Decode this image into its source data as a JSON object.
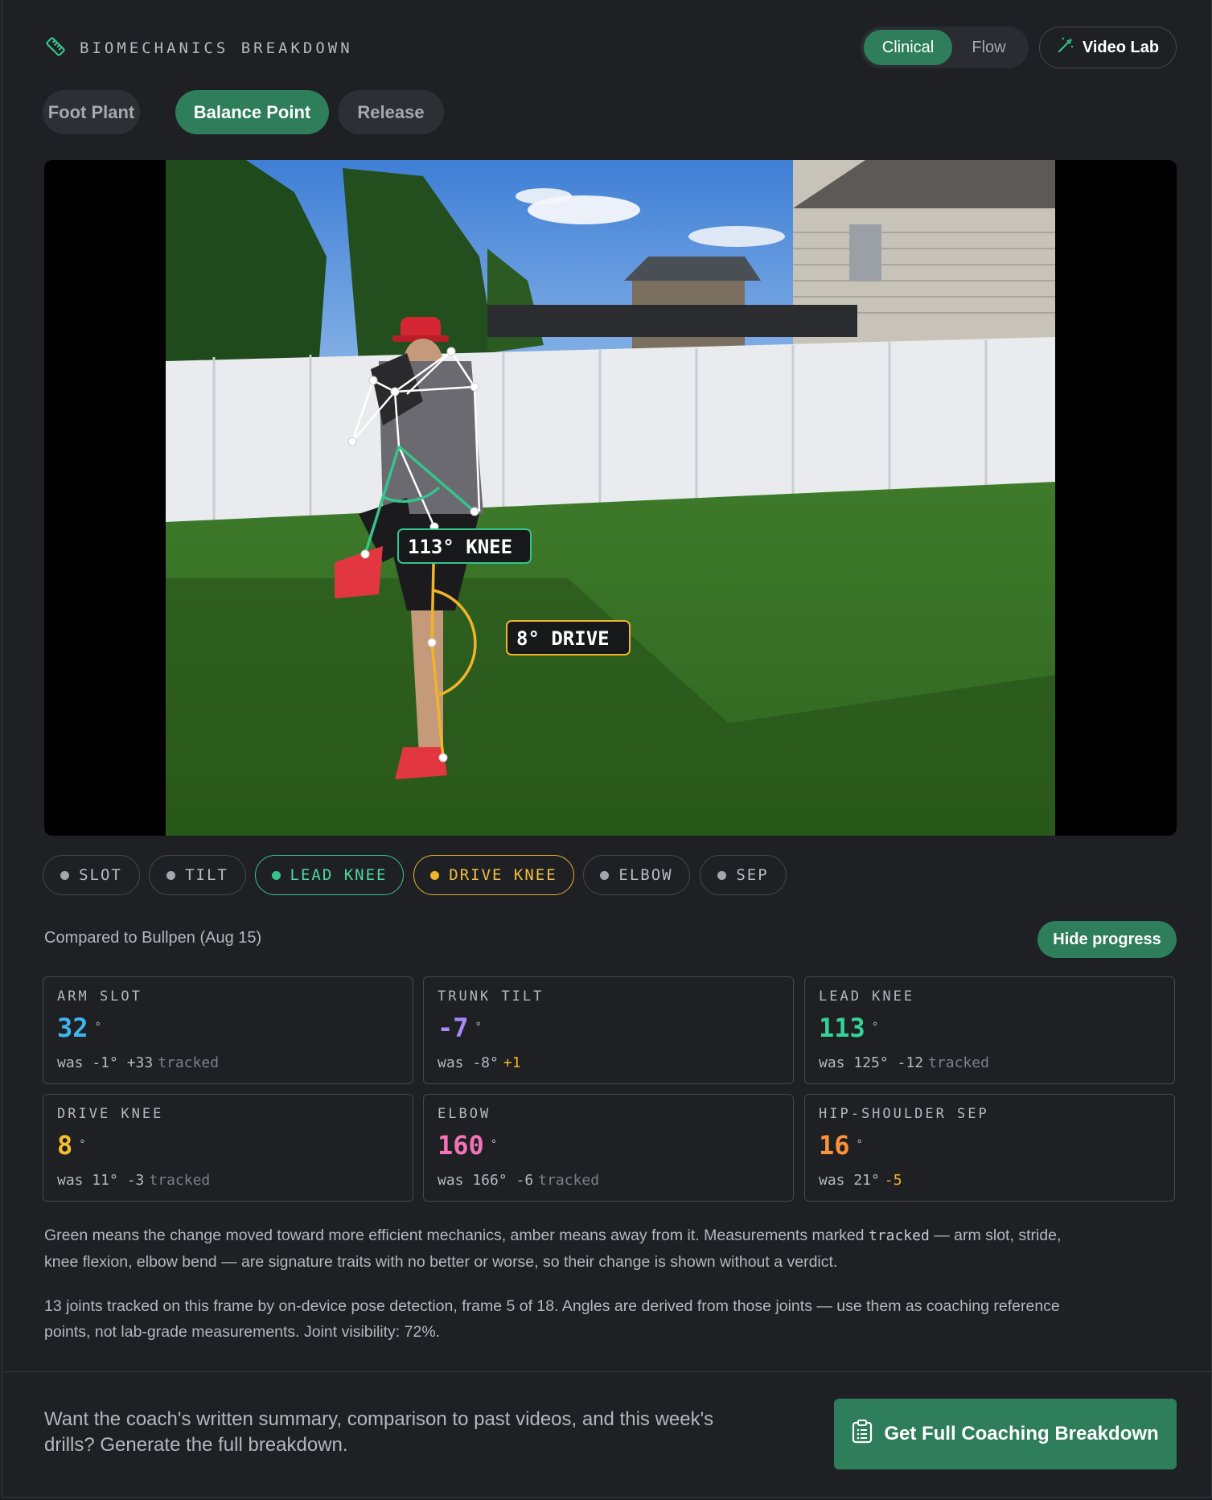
{
  "header": {
    "title": "BIOMECHANICS BREAKDOWN",
    "icon": "ruler-icon"
  },
  "view_toggle": {
    "options": [
      "Clinical",
      "Flow"
    ],
    "selected": "Clinical"
  },
  "video_lab": {
    "label": "Video Lab",
    "icon": "magic-wand-icon"
  },
  "phases": {
    "items": [
      "Foot Plant",
      "Balance Point",
      "Release"
    ],
    "selected": "Balance Point"
  },
  "video": {
    "overlays": {
      "knee_label": "113° KNEE",
      "drive_label": "8° DRIVE"
    },
    "colors": {
      "lead_knee": "#35c48c",
      "drive_knee": "#f0b429",
      "skeleton": "#ffffff"
    }
  },
  "metric_pills": [
    {
      "label": "SLOT",
      "state": "off"
    },
    {
      "label": "TILT",
      "state": "off"
    },
    {
      "label": "LEAD KNEE",
      "state": "green"
    },
    {
      "label": "DRIVE KNEE",
      "state": "amber"
    },
    {
      "label": "ELBOW",
      "state": "off"
    },
    {
      "label": "SEP",
      "state": "off"
    }
  ],
  "comparison": {
    "text": "Compared to Bullpen (Aug 15)",
    "toggle_label": "Hide progress"
  },
  "cards": [
    {
      "label": "ARM SLOT",
      "value": "32",
      "unit": "°",
      "was": "was -1°",
      "delta": "+33",
      "note": "tracked",
      "color": "#3fb5f0"
    },
    {
      "label": "TRUNK TILT",
      "value": "-7",
      "unit": "°",
      "was": "was -8°",
      "delta": "+1",
      "note": "",
      "color": "#a78bfa"
    },
    {
      "label": "LEAD KNEE",
      "value": "113",
      "unit": "°",
      "was": "was 125°",
      "delta": "-12",
      "note": "tracked",
      "color": "#35d39a"
    },
    {
      "label": "DRIVE KNEE",
      "value": "8",
      "unit": "°",
      "was": "was 11°",
      "delta": "-3",
      "note": "tracked",
      "color": "#f5c030"
    },
    {
      "label": "ELBOW",
      "value": "160",
      "unit": "°",
      "was": "was 166°",
      "delta": "-6",
      "note": "tracked",
      "color": "#f472b6"
    },
    {
      "label": "HIP-SHOULDER SEP",
      "value": "16",
      "unit": "°",
      "was": "was 21°",
      "delta": "-5",
      "note": "",
      "color": "#fb923c"
    }
  ],
  "legend_note": {
    "before": "Green means the change moved toward more efficient mechanics, amber means away from it. Measurements marked ",
    "code": "tracked",
    "after": " — arm slot, stride, knee flexion, elbow bend — are signature traits with no better or worse, so their change is shown without a verdict."
  },
  "detection_note": "13 joints tracked on this frame by on-device pose detection, frame 5 of 18. Angles are derived from those joints — use them as coaching reference points, not lab-grade measurements. Joint visibility: 72%.",
  "cta": {
    "text": "Want the coach's written summary, comparison to past videos, and this week's drills? Generate the full breakdown.",
    "button_label": "Get Full Coaching Breakdown",
    "icon": "clipboard-icon"
  }
}
